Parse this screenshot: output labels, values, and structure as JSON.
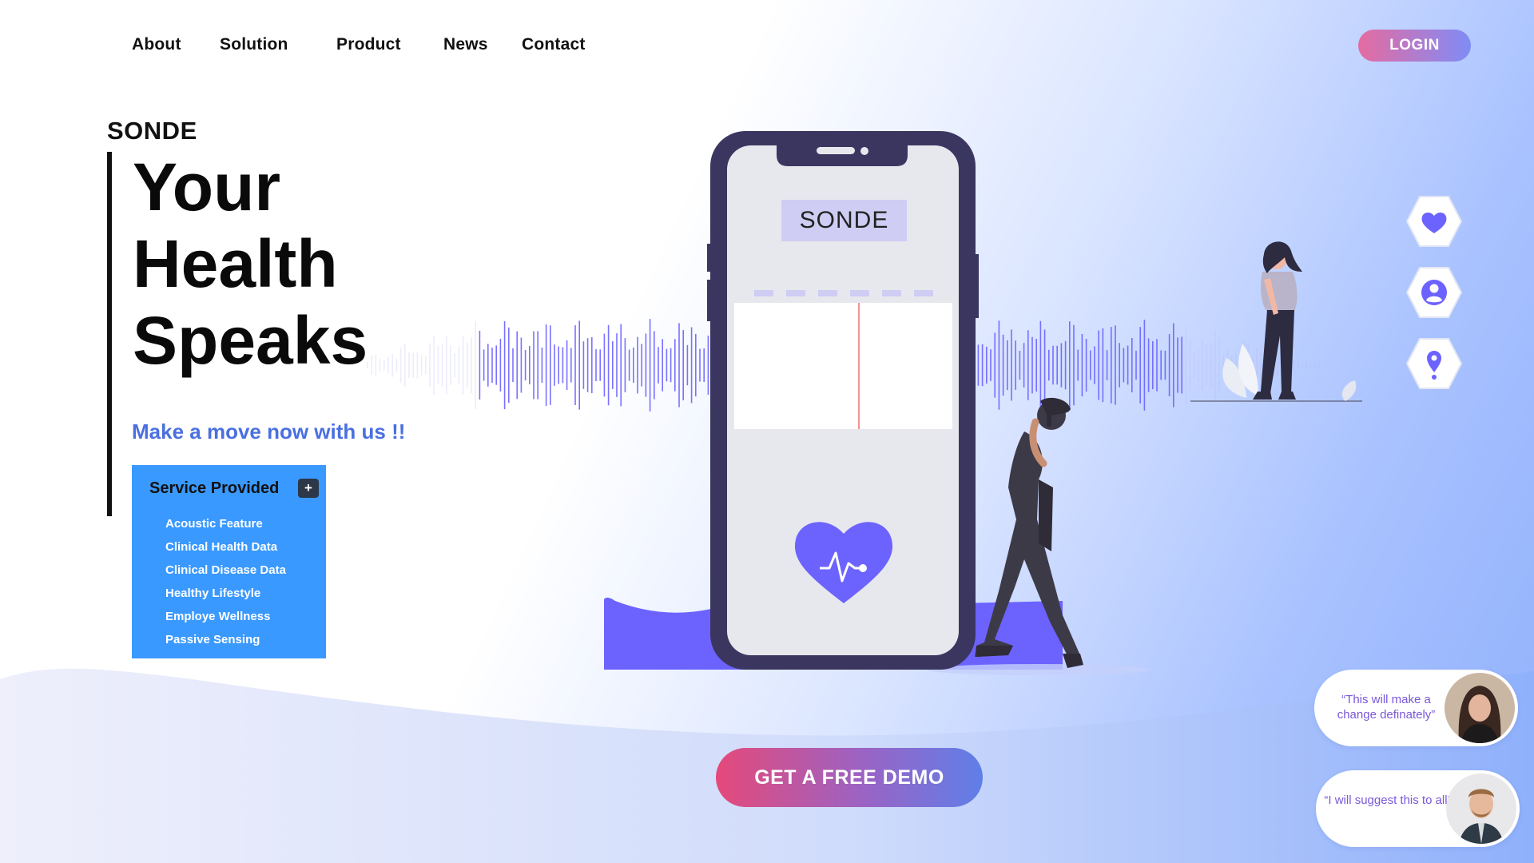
{
  "nav": {
    "links": [
      "About",
      "Solution",
      "Product",
      "News",
      "Contact"
    ],
    "login_label": "LOGIN"
  },
  "hero": {
    "brand": "SONDE",
    "headline": [
      "Your",
      "Health",
      "Speaks"
    ],
    "tagline": "Make a move now with us !!"
  },
  "services": {
    "title": "Service Provided",
    "toggle": "+",
    "items": [
      "Acoustic Feature",
      "Clinical Health Data",
      "Clinical Disease Data",
      "Healthy Lifestyle",
      "Employe Wellness",
      "Passive Sensing"
    ]
  },
  "phone": {
    "screen_label": "SONDE"
  },
  "side_icons": [
    "heart-icon",
    "user-icon",
    "location-pin-icon"
  ],
  "testimonials": [
    {
      "quote": "“This will make a change definately”"
    },
    {
      "quote": "“I will suggest this to all”"
    }
  ],
  "cta": {
    "demo_label": "GET A FREE DEMO"
  },
  "colors": {
    "accent": "#6c63ff",
    "service_bg": "#3a99ff",
    "tagline": "#4a6fe0",
    "phone_frame": "#3b3660",
    "quote_text": "#7a58d8"
  }
}
